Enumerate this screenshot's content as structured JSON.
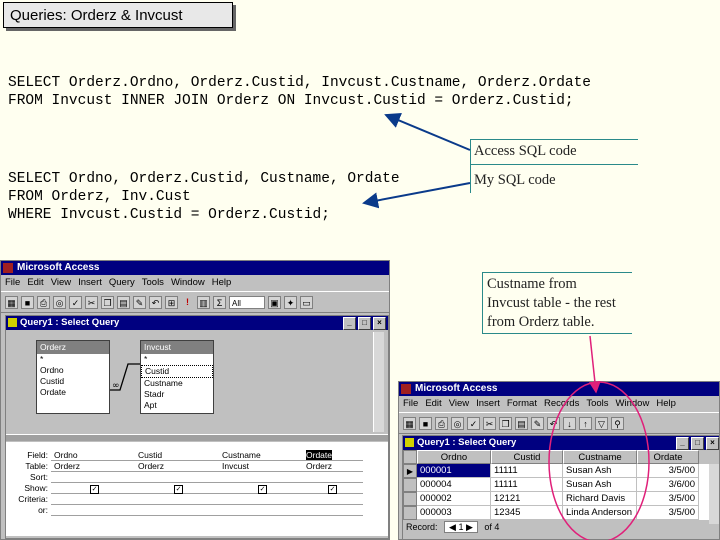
{
  "slide": {
    "title": "Queries: Orderz & Invcust",
    "sql_access": [
      "SELECT Orderz.Ordno, Orderz.Custid, Invcust.Custname, Orderz.Ordate",
      "FROM Invcust INNER JOIN Orderz ON Invcust.Custid = Orderz.Custid;"
    ],
    "sql_mine": [
      "SELECT Ordno, Orderz.Custid, Custname, Ordate",
      "FROM Orderz, Inv.Cust",
      "WHERE Invcust.Custid = Orderz.Custid;"
    ],
    "callout_access": "Access SQL code",
    "callout_mine": "My SQL code",
    "callout_custname": [
      "Custname from",
      "Invcust table - the rest",
      "from Orderz table."
    ]
  },
  "design_window": {
    "app_title": "Microsoft Access",
    "menu": [
      "File",
      "Edit",
      "View",
      "Insert",
      "Query",
      "Tools",
      "Window",
      "Help"
    ],
    "toolbar_combo": "All",
    "query_title": "Query1 : Select Query",
    "table_orderz": {
      "name": "Orderz",
      "fields": [
        "*",
        "Ordno",
        "Custid",
        "Ordate"
      ]
    },
    "table_invcust": {
      "name": "Invcust",
      "fields": [
        "*",
        "Custid",
        "Custname",
        "Stadr",
        "Apt"
      ]
    },
    "grid_labels": [
      "Field:",
      "Table:",
      "Sort:",
      "Show:",
      "Criteria:",
      "or:"
    ],
    "grid_columns": [
      {
        "field": "Ordno",
        "table": "Orderz",
        "show": "true"
      },
      {
        "field": "Custid",
        "table": "Orderz",
        "show": "true"
      },
      {
        "field": "Custname",
        "table": "Invcust",
        "show": "true"
      },
      {
        "field": "Ordate",
        "table": "Orderz",
        "show": "true"
      }
    ]
  },
  "datasheet_window": {
    "app_title": "Microsoft Access",
    "menu": [
      "File",
      "Edit",
      "View",
      "Insert",
      "Format",
      "Records",
      "Tools",
      "Window",
      "Help"
    ],
    "query_title": "Query1 : Select Query",
    "columns": [
      "Ordno",
      "Custid",
      "Custname",
      "Ordate"
    ],
    "rows": [
      [
        "000001",
        "11111",
        "Susan Ash",
        "3/5/00"
      ],
      [
        "000004",
        "11111",
        "Susan Ash",
        "3/6/00"
      ],
      [
        "000002",
        "12121",
        "Richard Davis",
        "3/5/00"
      ],
      [
        "000003",
        "12345",
        "Linda Anderson",
        "3/5/00"
      ]
    ],
    "record_label": "Record:",
    "record_of": "of 4"
  },
  "colors": {
    "callout_teal": "#2a8a8a",
    "arrow_blue": "#0a3a8a",
    "highlight_magenta": "#e0207a",
    "title_bar": "#000080"
  },
  "icons": [
    "access-logo-icon",
    "query-icon",
    "print-icon",
    "cut-icon",
    "copy-icon",
    "paste-icon",
    "run-icon",
    "sigma-icon"
  ]
}
